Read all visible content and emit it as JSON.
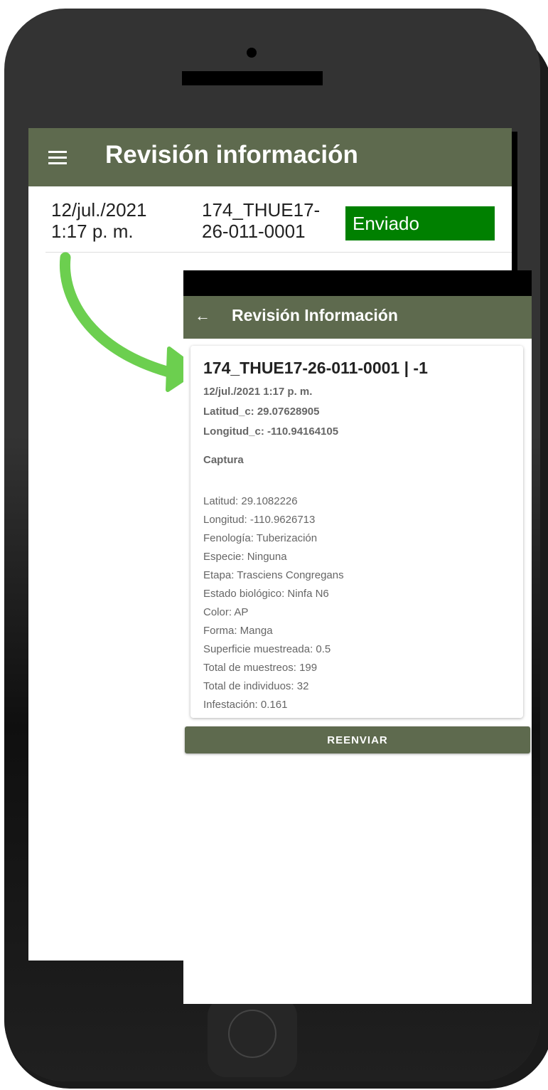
{
  "back_screen": {
    "title": "Revisión información",
    "record": {
      "date_line1": "12/jul./2021",
      "date_line2": "1:17 p. m.",
      "code_line1": "174_THUE17-",
      "code_line2": "26-011-0001",
      "status": "Enviado"
    }
  },
  "front_screen": {
    "title": "Revisión Información",
    "card": {
      "heading": "174_THUE17-26-011-0001 | -1",
      "timestamp": "12/jul./2021 1:17 p. m.",
      "lat_c": "Latitud_c: 29.07628905",
      "lon_c": "Longitud_c: -110.94164105",
      "section": "Captura",
      "details": [
        "Latitud: 29.1082226",
        "Longitud: -110.9626713",
        "Fenología: Tuberización",
        "Especie: Ninguna",
        "Etapa: Trasciens Congregans",
        "Estado biológico: Ninfa N6",
        "Color: AP",
        "Forma: Manga",
        "Superficie muestreada: 0.5",
        "Total de muestreos: 199",
        "Total de individuos: 32",
        "Infestación: 0.161"
      ]
    },
    "resend_label": "REENVIAR"
  },
  "colors": {
    "appbar": "#5e6a4e",
    "status_sent": "#008000",
    "arrow": "#6ccf4f"
  },
  "icons": [
    "menu-icon",
    "back-arrow-icon"
  ]
}
